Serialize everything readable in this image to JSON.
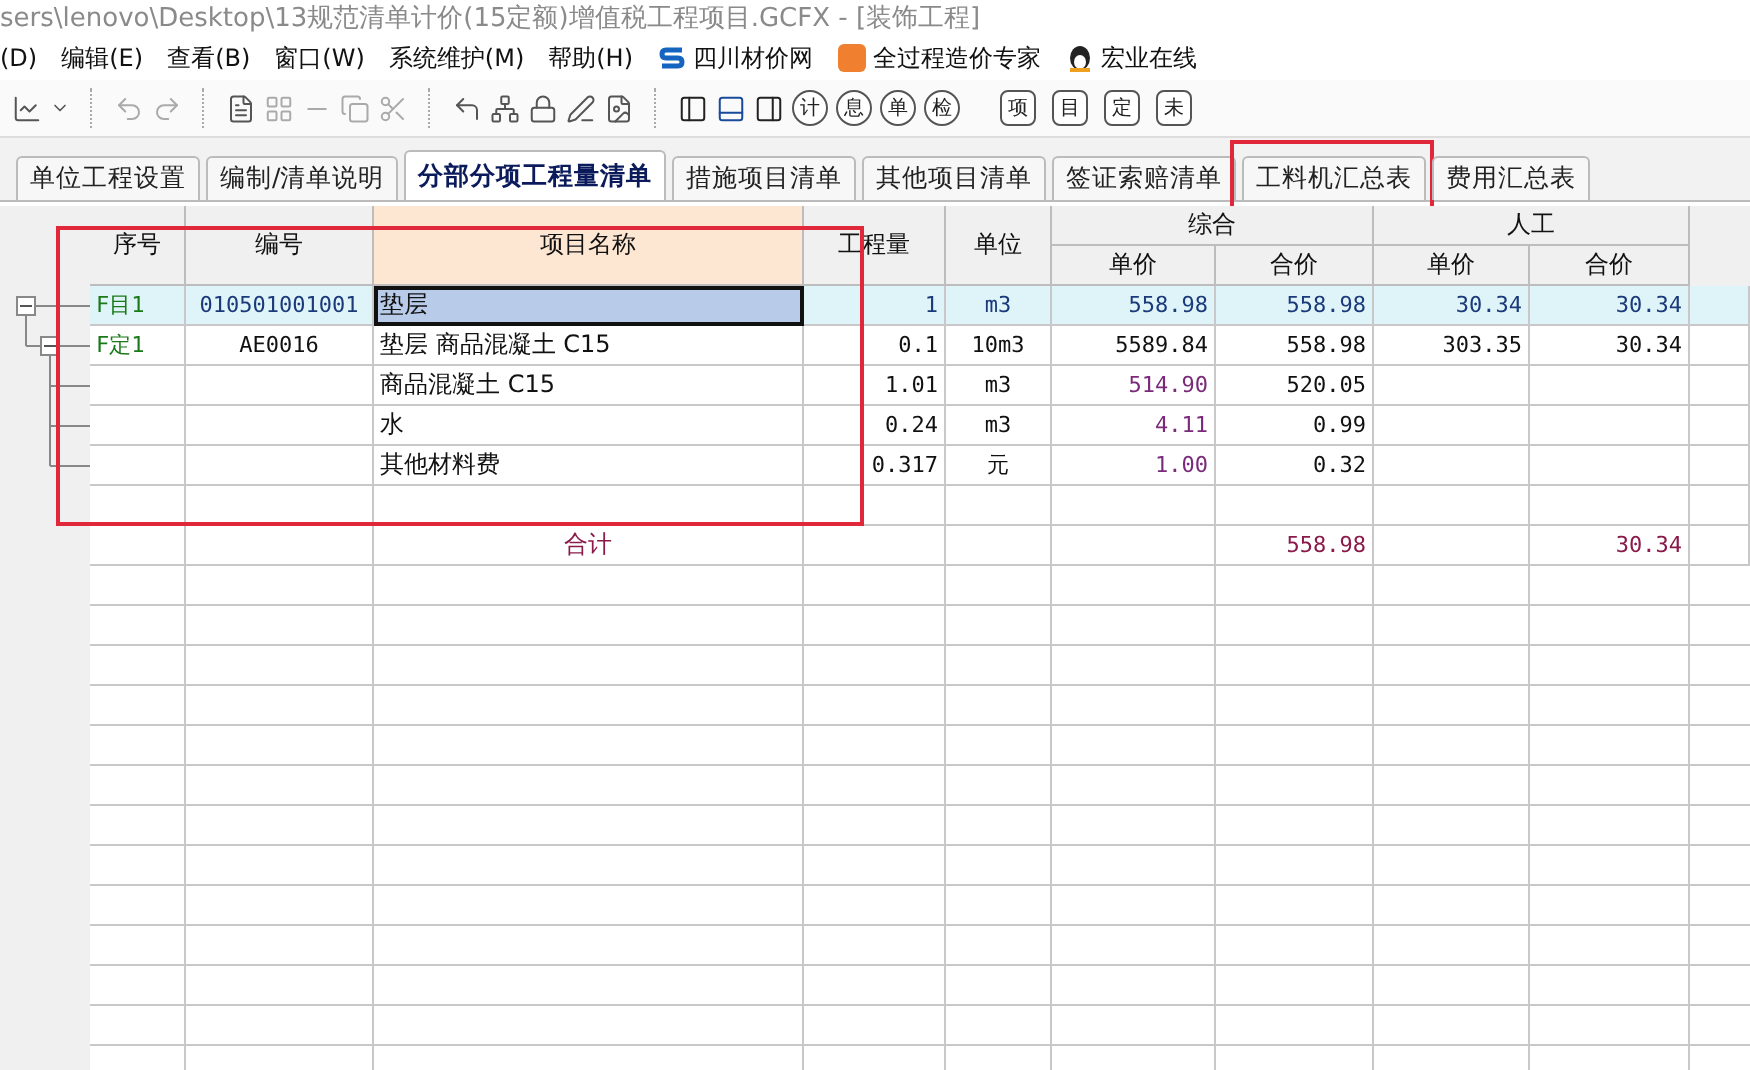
{
  "window": {
    "title": "sers\\lenovo\\Desktop\\13规范清单计价(15定额)增值税工程项目.GCFX - [装饰工程]"
  },
  "menu": [
    {
      "label": "(D)",
      "kind": "text"
    },
    {
      "label": "编辑(E)",
      "kind": "text"
    },
    {
      "label": "查看(B)",
      "kind": "text"
    },
    {
      "label": "窗口(W)",
      "kind": "text"
    },
    {
      "label": "系统维护(M)",
      "kind": "text"
    },
    {
      "label": "帮助(H)",
      "kind": "text"
    },
    {
      "label": "四川材价网",
      "kind": "s-logo"
    },
    {
      "label": "全过程造价专家",
      "kind": "orange-logo"
    },
    {
      "label": "宏业在线",
      "kind": "penguin"
    }
  ],
  "toolbar": {
    "circled": [
      "计",
      "息",
      "单",
      "检"
    ],
    "boxed": [
      "项",
      "目",
      "定",
      "未"
    ]
  },
  "tabs": [
    {
      "label": "单位工程设置",
      "selected": false,
      "highlighted": false
    },
    {
      "label": "编制/清单说明",
      "selected": false,
      "highlighted": false
    },
    {
      "label": "分部分项工程量清单",
      "selected": true,
      "highlighted": false
    },
    {
      "label": "措施项目清单",
      "selected": false,
      "highlighted": false
    },
    {
      "label": "其他项目清单",
      "selected": false,
      "highlighted": false
    },
    {
      "label": "签证索赔清单",
      "selected": false,
      "highlighted": false
    },
    {
      "label": "工料机汇总表",
      "selected": false,
      "highlighted": true
    },
    {
      "label": "费用汇总表",
      "selected": false,
      "highlighted": false
    }
  ],
  "table": {
    "highlighted": true,
    "columns": {
      "seq": "序号",
      "code": "编号",
      "name": "项目名称",
      "qty": "工程量",
      "unit": "单位",
      "composite": "综合",
      "labor": "人工",
      "unit_price": "单价",
      "total_price": "合价",
      "labor_unit": "单价",
      "labor_total": "合价"
    },
    "rows": [
      {
        "kind": "item",
        "expanded": true,
        "selected": true,
        "seq": "F目1",
        "code": "010501001001",
        "name": "垫层",
        "qty": "1",
        "unit": "m3",
        "unit_price": "558.98",
        "total_price": "558.98",
        "labor_unit": "30.34",
        "labor_total": "30.34"
      },
      {
        "kind": "quota",
        "expanded": true,
        "selected": false,
        "seq": "F定1",
        "code": "AE0016",
        "name": "垫层 商品混凝土 C15",
        "qty": "0.1",
        "unit": "10m3",
        "unit_price": "5589.84",
        "total_price": "558.98",
        "labor_unit": "303.35",
        "labor_total": "30.34"
      },
      {
        "kind": "material",
        "name": "商品混凝土 C15",
        "qty": "1.01",
        "unit": "m3",
        "unit_price": "514.90",
        "total_price": "520.05"
      },
      {
        "kind": "material",
        "name": "水",
        "qty": "0.24",
        "unit": "m3",
        "unit_price": "4.11",
        "total_price": "0.99"
      },
      {
        "kind": "material",
        "name": "其他材料费",
        "qty": "0.317",
        "unit": "元",
        "unit_price": "1.00",
        "total_price": "0.32"
      },
      {
        "kind": "blank"
      },
      {
        "kind": "total",
        "name": "合计",
        "total_price": "558.98",
        "labor_total": "30.34"
      }
    ]
  }
}
